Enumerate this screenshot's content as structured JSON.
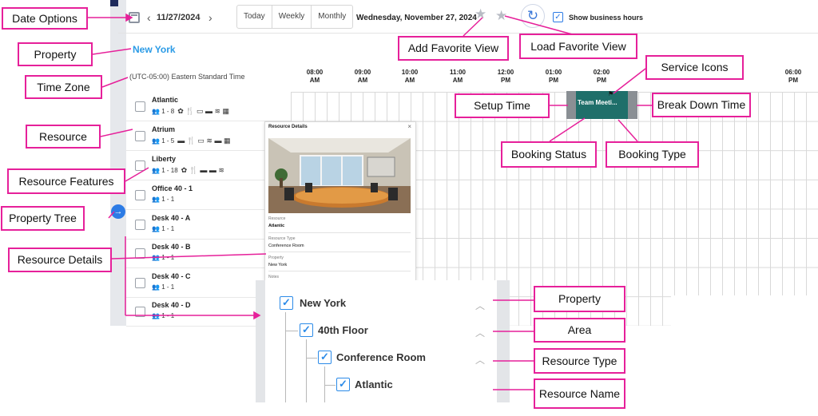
{
  "toolbar": {
    "date": "11/27/2024",
    "view_options": [
      "Today",
      "Weekly",
      "Monthly"
    ],
    "long_date": "Wednesday, November 27, 2024",
    "show_business_hours": "Show business hours"
  },
  "property": "New York",
  "timezone": "(UTC-05:00) Eastern Standard Time",
  "times": [
    {
      "t": "08:00",
      "p": "AM"
    },
    {
      "t": "09:00",
      "p": "AM"
    },
    {
      "t": "10:00",
      "p": "AM"
    },
    {
      "t": "11:00",
      "p": "AM"
    },
    {
      "t": "12:00",
      "p": "PM"
    },
    {
      "t": "01:00",
      "p": "PM"
    },
    {
      "t": "02:00",
      "p": "PM"
    },
    {
      "t": "06:00",
      "p": "PM"
    }
  ],
  "resources": [
    {
      "name": "Atlantic",
      "capacity": "1 - 8",
      "features": "✿ 🍴 ▭ ▬ ≋ ▦"
    },
    {
      "name": "Atrium",
      "capacity": "1 - 5",
      "features": "▬ 🍴 ▭ ≋ ▬ ▦"
    },
    {
      "name": "Liberty",
      "capacity": "1 - 18",
      "features": "✿ 🍴 ▬ ▬ ≋"
    },
    {
      "name": "Office 40 - 1",
      "capacity": "1 - 1",
      "features": ""
    },
    {
      "name": "Desk 40 - A",
      "capacity": "1 - 1",
      "features": ""
    },
    {
      "name": "Desk 40 - B",
      "capacity": "1 - 1",
      "features": ""
    },
    {
      "name": "Desk 40 - C",
      "capacity": "1 - 1",
      "features": ""
    },
    {
      "name": "Desk 40 - D",
      "capacity": "1 - 1",
      "features": ""
    }
  ],
  "booking": {
    "label": "Team Meeti..."
  },
  "details": {
    "title": "Resource Details",
    "resource_label": "Resource",
    "resource_value": "Atlantic",
    "type_label": "Resource Type",
    "type_value": "Conference Room",
    "property_label": "Property",
    "property_value": "New York",
    "notes_label": "Notes"
  },
  "tree": {
    "property": "New York",
    "area": "40th Floor",
    "resource_type": "Conference Room",
    "resource": "Atlantic"
  },
  "callouts": {
    "date_options": "Date Options",
    "property": "Property",
    "time_zone": "Time Zone",
    "resource": "Resource",
    "resource_features": "Resource Features",
    "property_tree": "Property Tree",
    "resource_details": "Resource Details",
    "add_favorite": "Add Favorite View",
    "load_favorite": "Load Favorite View",
    "service_icons": "Service Icons",
    "setup_time": "Setup Time",
    "break_down_time": "Break Down Time",
    "booking_status": "Booking Status",
    "booking_type": "Booking Type",
    "tree_property": "Property",
    "tree_area": "Area",
    "tree_resource_type": "Resource Type",
    "tree_resource_name": "Resource Name"
  },
  "colors": {
    "accent": "#2b9be6",
    "callout_border": "#e6209a",
    "booking": "#1f6f6a",
    "setup": "#8a8f94"
  }
}
